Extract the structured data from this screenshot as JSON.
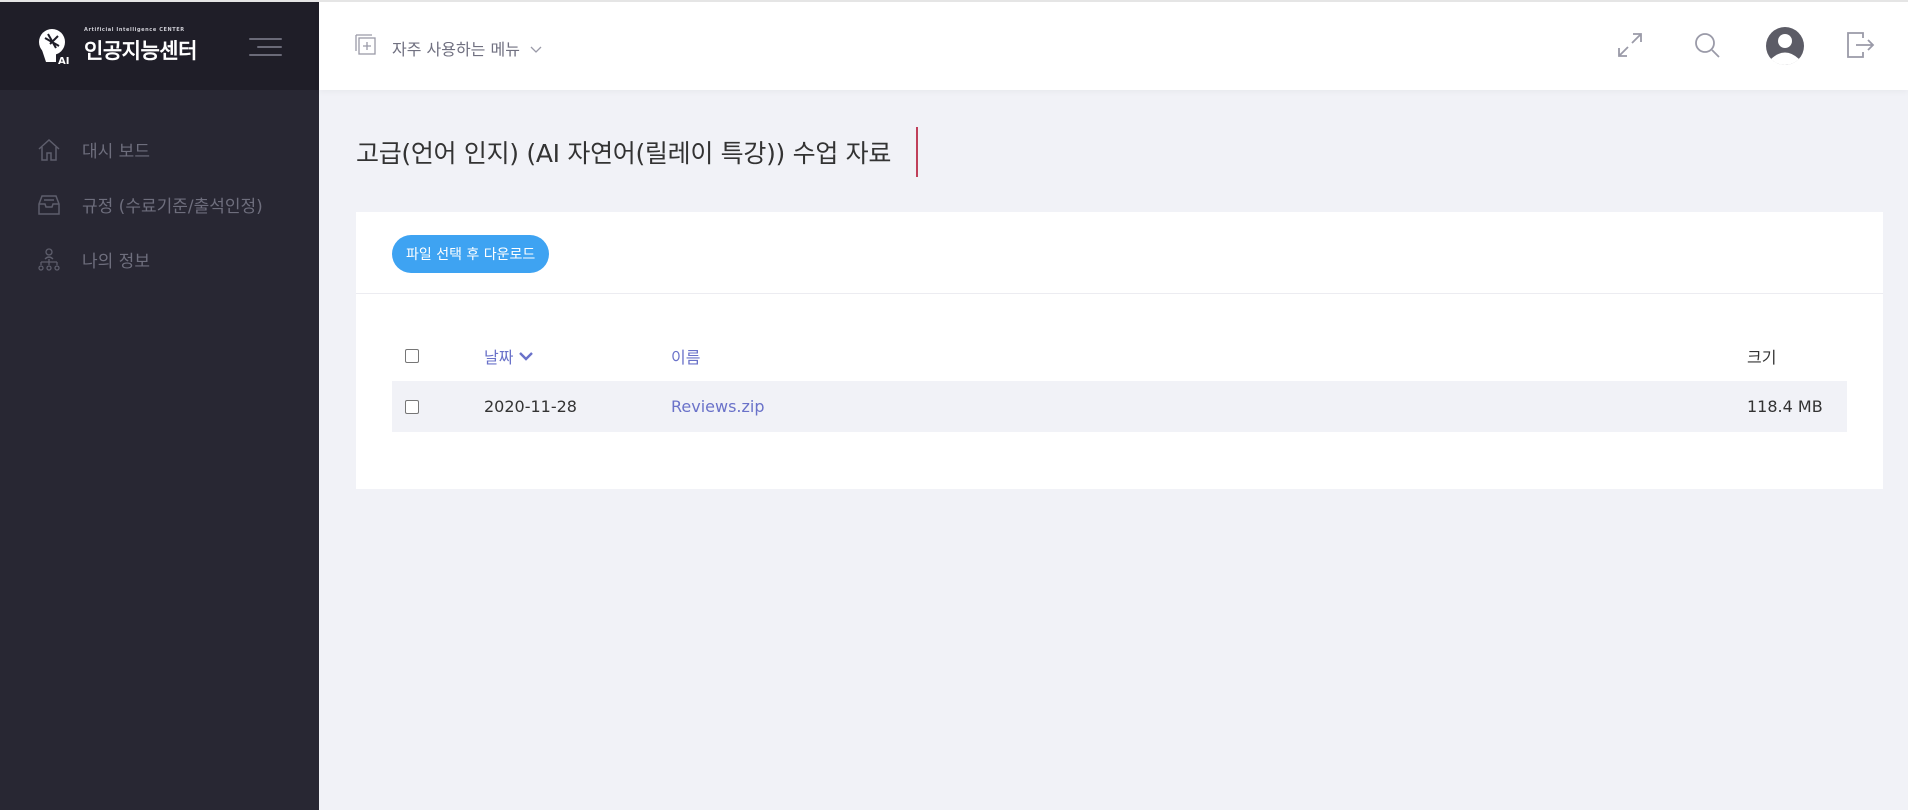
{
  "sidebar": {
    "logo": {
      "subtitle": "Artificial Intelligence CENTER",
      "title": "인공지능센터"
    },
    "items": [
      {
        "label": "대시 보드",
        "icon": "home-icon"
      },
      {
        "label": "규정 (수료기준/출석인정)",
        "icon": "inbox-icon"
      },
      {
        "label": "나의 정보",
        "icon": "org-chart-icon"
      }
    ]
  },
  "header": {
    "favorites_label": "자주 사용하는 메뉴",
    "icons": [
      "fullscreen-icon",
      "search-icon",
      "avatar",
      "logout-icon"
    ]
  },
  "main": {
    "title": "고급(언어 인지) (AI 자연어(릴레이 특강)) 수업 자료",
    "download_button": "파일 선택 후 다운로드",
    "table": {
      "columns": {
        "date": "날짜",
        "name": "이름",
        "size": "크기"
      },
      "rows": [
        {
          "date": "2020-11-28",
          "name": "Reviews.zip",
          "size": "118.4 MB"
        }
      ]
    }
  },
  "colors": {
    "sidebar_bg": "#282733",
    "sidebar_top_bg": "#1f1e28",
    "accent_button": "#3ea3f2",
    "link": "#6a72c9",
    "title_bar": "#c0405a",
    "page_bg": "#f1f2f7"
  }
}
